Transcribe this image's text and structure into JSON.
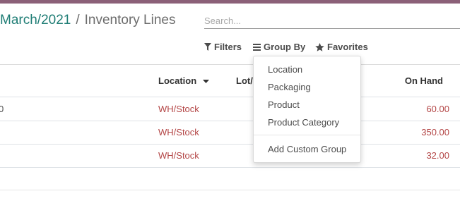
{
  "breadcrumb": {
    "parent": "March/2021",
    "separator": "/",
    "current": "Inventory Lines"
  },
  "search": {
    "placeholder": "Search..."
  },
  "search_panel": {
    "filters_label": "Filters",
    "group_by_label": "Group By",
    "favorites_label": "Favorites"
  },
  "table": {
    "columns": {
      "location": "Location",
      "lot": "Lot/",
      "on_hand": "On Hand"
    },
    "rows": [
      {
        "lead": "0",
        "location": "WH/Stock",
        "on_hand": "60.00"
      },
      {
        "lead": "",
        "location": "WH/Stock",
        "on_hand": "350.00"
      },
      {
        "lead": "",
        "location": "WH/Stock",
        "on_hand": "32.00"
      }
    ]
  },
  "group_by_menu": {
    "items": [
      "Location",
      "Packaging",
      "Product",
      "Product Category"
    ],
    "custom": "Add Custom Group"
  },
  "colors": {
    "link": "#1f7d75",
    "value": "#b34545",
    "topbar": "#8b6078"
  }
}
